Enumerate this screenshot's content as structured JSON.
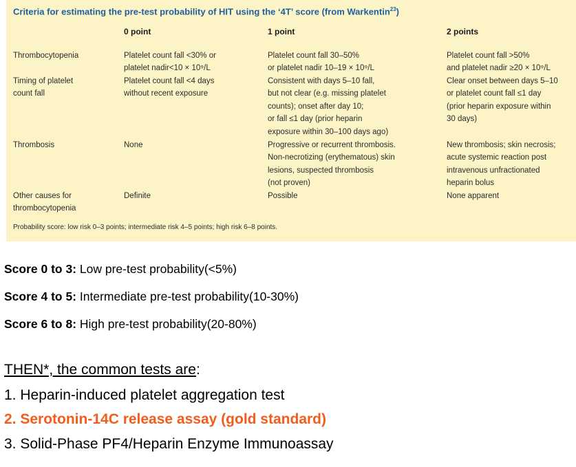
{
  "table": {
    "title": "Criteria for estimating the pre-test probability of HIT using the ‘4T’ score (from Warkentin",
    "title_ref": "23",
    "title_close": ")",
    "columns": [
      "0 point",
      "1 point",
      "2 points"
    ],
    "rows": [
      {
        "label": "Thrombocytopenia",
        "c0": "Platelet count fall <30% or\nplatelet nadir<10 × 10⁹/L",
        "c1": "Platelet count fall 30–50%\nor platelet nadir 10–19 × 10⁹/L",
        "c2": "Platelet count fall >50%\nand platelet nadir ≥20 × 10⁹/L"
      },
      {
        "label": "Timing of platelet\ncount fall",
        "c0": "Platelet count fall <4 days\nwithout recent exposure",
        "c1": "Consistent with days 5–10 fall,\nbut not clear (e.g. missing platelet\ncounts); onset after day 10;\nor fall ≤1 day (prior heparin\nexposure within 30–100 days ago)",
        "c2": "Clear onset between days 5–10\nor platelet count fall ≤1 day\n(prior heparin exposure within\n30 days)"
      },
      {
        "label": "Thrombosis",
        "c0": "None",
        "c1": "Progressive or recurrent thrombosis.\nNon-necrotizing (erythematous) skin\nlesions, suspected thrombosis\n(not proven)",
        "c2": "New thrombosis; skin necrosis;\nacute systemic reaction post\nintravenous unfractionated\nheparin bolus"
      },
      {
        "label": "Other causes for\nthrombocytopenia",
        "c0": "Definite",
        "c1": "Possible",
        "c2": "None apparent"
      }
    ],
    "footnote": "Probability score: low risk 0–3 points; intermediate risk 4–5 points; high risk 6–8 points."
  },
  "scores": [
    {
      "label": "Score 0 to 3:",
      "text": " Low pre-test probability(<5%)"
    },
    {
      "label": "Score 4 to 5:",
      "text": " Intermediate pre-test probability(10-30%)"
    },
    {
      "label": "Score 6 to 8:",
      "text": " High pre-test probability(20-80%)"
    }
  ],
  "then": {
    "underlined": "THEN*, the common tests are",
    "suffix": ":"
  },
  "tests": [
    "1. Heparin-induced platelet aggregation test",
    "2. Serotonin-14C release assay (gold standard)",
    "3. Solid-Phase PF4/Heparin Enzyme Immunoassay"
  ],
  "colors": {
    "table_bg": "#fcf4c7",
    "title": "#1f5f9e",
    "highlight": "#f35d1c"
  }
}
